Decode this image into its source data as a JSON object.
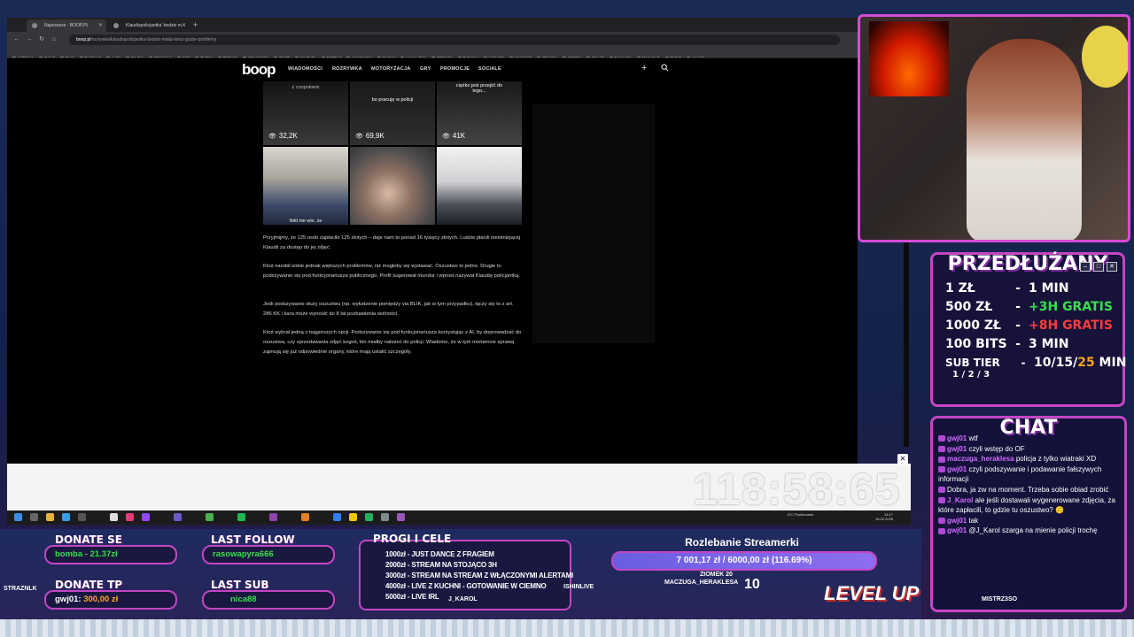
{
  "browser": {
    "tabs": [
      {
        "title": "Najnowsze - BOOP.PL"
      },
      {
        "title": "Klaudiapolicjantka' bedzie m..."
      }
    ],
    "url_host": "boop.pl",
    "url_path": "/rozrywka/klaudiapolicjantka-bedzie-miala-teraz-grube-problemy",
    "bookmarks": [
      "Aplikacje",
      "Gmail",
      "Dysk",
      "facebook",
      "work",
      "Oculus",
      "Itchio/Live",
      "Kick",
      "Twitter",
      "TikFinity",
      "Streamlabs",
      "Grafik",
      "YouTube",
      "BEZD.pl",
      "IceMonster",
      "Games",
      "Łowcy Gier",
      "OGdeals",
      "Behance",
      "LinkedIn",
      "Unsplash",
      "Shinden",
      "STOCK",
      "Gry Inf",
      "Norwegia",
      "Memory 5",
      "Twitch",
      "wesele"
    ]
  },
  "site": {
    "logo": "boop",
    "nav": [
      "WIADOMOŚCI",
      "ROZRYWKA",
      "MOTORYZACJA",
      "GRY",
      "PROMOCJE",
      "SOCIALE"
    ],
    "plus": "+"
  },
  "article": {
    "tiles": [
      {
        "overlay": "z cnopokiem",
        "views": "32,2K"
      },
      {
        "overlay": "bo pracuję w policji",
        "views": "69,9K"
      },
      {
        "overlay": "ciężko jest przejść do tego...",
        "views": "41K"
      },
      {
        "overlay": "Nikt nie wie, że",
        "views": ""
      },
      {
        "overlay": "",
        "views": ""
      },
      {
        "overlay": "",
        "views": ""
      }
    ],
    "paragraphs": [
      "Przyjmijmy, że 125 osób zapłaciło 125 złotych – daje nam to ponad 16 tysięcy złotych. Ludzie płacili nieistniejącej Klaudii za dostęp do jej zdjęć.",
      "Ktoś narobił sobie jednak większych problemów, niż mogłoby się wydawać. Oszustwo to jedno. Drugie to podszywanie się pod funkcjonariusza publicznego. Profil sugerował mundur i wprost nazywał Klaudię policjantką.",
      "Jeśli podszywanie służy oszustwu (np. wyłudzenie pieniędzy via BLIK, jak w tym przypadku), łączy się to z art. 286 KK i kara może wynosić do 8 lat pozbawienia wolności.",
      "Ktoś wybrał jedną z najgorszych opcji. Podszywanie się pod funkcjonariusza korzystając z AI, by doprowadzać do oszustwa, czy sprzedawania zdjęć kogoś, kto miałby należeć do policji. Wiadomo, że w tym momencie sprawą zajmują się już odpowiednie organy, które mają ustalić szczegóły."
    ]
  },
  "timer": "118:58:65",
  "taskbar": {
    "weather": "-5°C Pochmurnie",
    "time": "13:17",
    "date": "16.02.2025"
  },
  "promo": {
    "title": "PRZEDŁUŻANY",
    "rows": [
      {
        "left": "1 ZŁ",
        "right": "1 MIN"
      },
      {
        "left": "500 ZŁ",
        "right": "+3H GRATIS"
      },
      {
        "left": "1000 ZŁ",
        "right": "+8H GRATIS"
      },
      {
        "left": "100 BITS",
        "right": "3 MIN"
      },
      {
        "left": "SUB TIER",
        "sub": "1 / 2 / 3",
        "right_a": "10/15/",
        "right_b": "25",
        "right_c": " MIN"
      }
    ],
    "dash": "-",
    "accent": "#c445c4"
  },
  "chat": {
    "title": "CHAT",
    "messages": [
      {
        "user": "gwj01",
        "text": "wtf"
      },
      {
        "user": "gwj01",
        "text": "czyli wstęp do OF"
      },
      {
        "user": "maczuga_heraklesa",
        "text": "policja z tylko wiatraki XD"
      },
      {
        "user": "gwj01",
        "text": "czyli podszywanie i podawanie fałszywych informacji"
      },
      {
        "user": "",
        "text": "Dobra, ja zw na moment. Trzeba sobie obiad zrobić"
      },
      {
        "user": "J_Karol",
        "text": "ale jeśli dostawali wygenerowane zdjęcia, za które zapłacili, to gdzie tu oszustwo? 🙃"
      },
      {
        "user": "gwj01",
        "text": "tak"
      },
      {
        "user": "gwj01",
        "text": "@J_Karol szarga na mienie policji trochę"
      }
    ]
  },
  "overlay": {
    "donate_se_label": "DONATE SE",
    "donate_se_value": "bomba - 21.37zł",
    "last_follow_label": "LAST FOLLOW",
    "last_follow_value": "rasowapyra666",
    "donate_tp_label": "DONATE TP",
    "donate_tp_user": "gwj01:",
    "donate_tp_amount": "300,00 zł",
    "last_sub_label": "LAST SUB",
    "last_sub_value": "nica88",
    "goals_title": "PROGI I CELE",
    "goals": [
      "1000zł - JUST DANCE Z FRAGIEM",
      "2000zł - STREAM NA STOJĄCO 3H",
      "3000zł - STREAM NA STREAM Z WŁĄCZONYMI ALERTAMI",
      "4000zł - LIVE Z KUCHNI - GOTOWANIE W CIEMNO",
      "5000zł - LIVE IRL"
    ],
    "streamerki_title": "Rozlebanie Streamerki",
    "streamerki_progress": "7 001,17 zł / 6000,00 zł (116.69%)",
    "names_row": "MACZUGA_HERAKLESA",
    "score": "10",
    "level_up": "LEVEL UP",
    "tags": [
      "ISHINLIVE",
      "J_KAROL",
      "MISTRZ3SO",
      "STRAZNLK",
      "ZIOMEK 20"
    ]
  }
}
